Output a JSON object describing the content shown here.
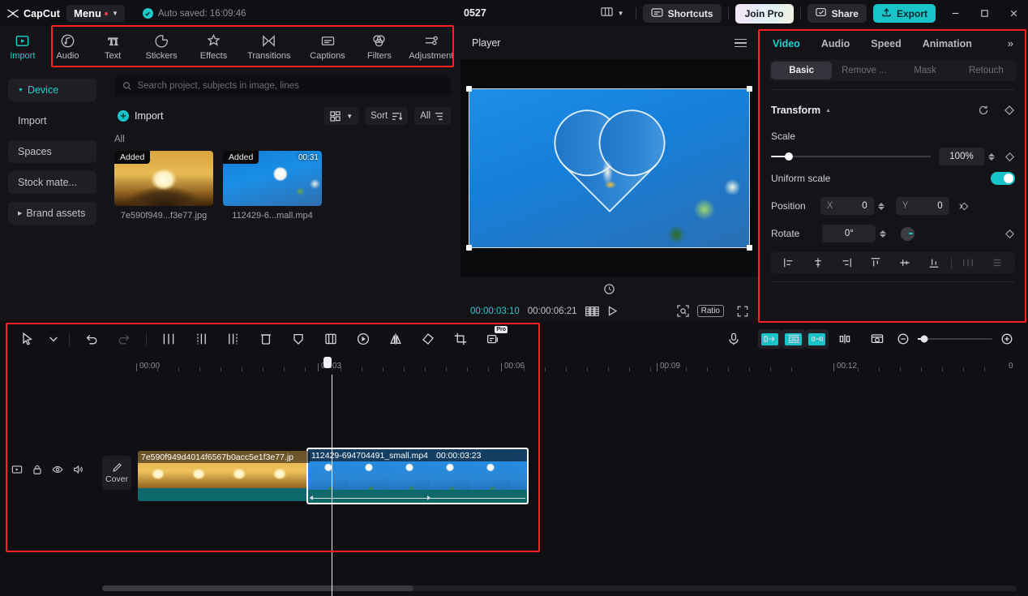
{
  "app": {
    "name": "CapCut",
    "menu_label": "Menu",
    "autosave": "Auto saved: 16:09:46",
    "project_title": "0527"
  },
  "titlebar": {
    "shortcuts_label": "Shortcuts",
    "join_pro_label": "Join Pro",
    "share_label": "Share",
    "export_label": "Export",
    "minimize_icon": "minimize-icon",
    "maximize_icon": "maximize-icon",
    "close_icon": "close-icon",
    "layout_icon": "layout-icon"
  },
  "module_tabs": [
    {
      "label": "Import",
      "icon": "import-icon",
      "active": true
    },
    {
      "label": "Audio",
      "icon": "audio-note-icon",
      "active": false
    },
    {
      "label": "Text",
      "icon": "text-ti-icon",
      "active": false
    },
    {
      "label": "Stickers",
      "icon": "sticker-icon",
      "active": false
    },
    {
      "label": "Effects",
      "icon": "effects-sparkle-icon",
      "active": false
    },
    {
      "label": "Transitions",
      "icon": "transitions-icon",
      "active": false
    },
    {
      "label": "Captions",
      "icon": "captions-icon",
      "active": false
    },
    {
      "label": "Filters",
      "icon": "filters-circles-icon",
      "active": false
    },
    {
      "label": "Adjustment",
      "icon": "adjustment-sliders-icon",
      "active": false
    }
  ],
  "sidebar": {
    "items": [
      {
        "label": "Device",
        "active": true,
        "expander": "down"
      },
      {
        "label": "Import",
        "active": false,
        "expander": "none"
      },
      {
        "label": "Spaces",
        "active": false,
        "expander": "none"
      },
      {
        "label": "Stock mate...",
        "active": false,
        "expander": "none"
      },
      {
        "label": "Brand assets",
        "active": false,
        "expander": "right"
      }
    ]
  },
  "library": {
    "search_placeholder": "Search project, subjects in image, lines",
    "search_value": "",
    "import_label": "Import",
    "sort_label": "Sort",
    "filter_label": "All",
    "section_label": "All",
    "media": [
      {
        "name": "7e590f949...f3e77.jpg",
        "badge": "Added",
        "duration": "",
        "kind": "hands"
      },
      {
        "name": "112429-6...mall.mp4",
        "badge": "Added",
        "duration": "00:31",
        "kind": "flower"
      }
    ]
  },
  "player": {
    "title": "Player",
    "current_time": "00:00:03:10",
    "total_time": "00:00:06:21",
    "ratio_label": "Ratio",
    "menu_icon": "hamburger-icon",
    "reset_icon": "reset-transform-icon",
    "play_icon": "play-icon",
    "grid_icon": "frames-grid-icon",
    "zoom_icon": "zoom-fit-icon",
    "fullscreen_icon": "fullscreen-icon"
  },
  "right_panel": {
    "tabs": [
      {
        "label": "Video",
        "active": true
      },
      {
        "label": "Audio",
        "active": false
      },
      {
        "label": "Speed",
        "active": false
      },
      {
        "label": "Animation",
        "active": false
      }
    ],
    "overflow_icon": "chevron-right-double-icon",
    "subtabs": [
      {
        "label": "Basic",
        "active": true
      },
      {
        "label": "Remove ...",
        "active": false
      },
      {
        "label": "Mask",
        "active": false
      },
      {
        "label": "Retouch",
        "active": false
      }
    ],
    "transform": {
      "title": "Transform",
      "reset_icon": "reset-icon",
      "keyframe_icon": "keyframe-diamond-icon",
      "scale_label": "Scale",
      "scale_value": "100%",
      "uniform_scale_label": "Uniform scale",
      "uniform_scale_on": true,
      "position_label": "Position",
      "position_x_label": "X",
      "position_x_value": "0",
      "position_y_label": "Y",
      "position_y_value": "0",
      "rotate_label": "Rotate",
      "rotate_value": "0°",
      "align_icons": [
        "align-left-icon",
        "align-center-horizontal-icon",
        "align-right-icon",
        "align-top-icon",
        "align-center-vertical-icon",
        "align-bottom-icon",
        "distribute-horizontal-icon",
        "distribute-vertical-icon"
      ]
    }
  },
  "timeline": {
    "tools": [
      "select-arrow-icon",
      "chevron-down-icon",
      "undo-icon",
      "redo-icon",
      "split-icon",
      "trim-left-icon",
      "trim-right-icon",
      "delete-icon",
      "mask-shield-icon",
      "mirror-split-icon",
      "keyframe-play-icon",
      "flip-icon",
      "rotate-shape-icon",
      "crop-icon",
      "auto-caption-pro-icon"
    ],
    "pro_badge": "Pro",
    "right_tools": [
      "microphone-icon",
      "split-left-cyan-icon",
      "auto-cut-cyan-icon",
      "split-right-cyan-icon",
      "cut-marker-icon",
      "snapshot-icon",
      "zoom-out-icon",
      "zoom-in-icon"
    ],
    "ruler_labels": [
      "00:00",
      "00:03",
      "00:06",
      "00:09",
      "00:12",
      "0"
    ],
    "track_controls": [
      "main-track-icon",
      "lock-icon",
      "eye-icon",
      "volume-icon"
    ],
    "cover_label": "Cover",
    "cover_icon": "pencil-icon",
    "clips": [
      {
        "name": "7e590f949d4014f6567b0acc5e1f3e77.jp",
        "duration": "",
        "kind": "hands",
        "selected": false
      },
      {
        "name": "112429-694704491_small.mp4",
        "duration": "00:00:03:23",
        "kind": "flower",
        "selected": true
      }
    ]
  },
  "highlights": [
    {
      "name": "module-tabs-highlight"
    },
    {
      "name": "right-panel-highlight"
    },
    {
      "name": "timeline-highlight"
    }
  ]
}
